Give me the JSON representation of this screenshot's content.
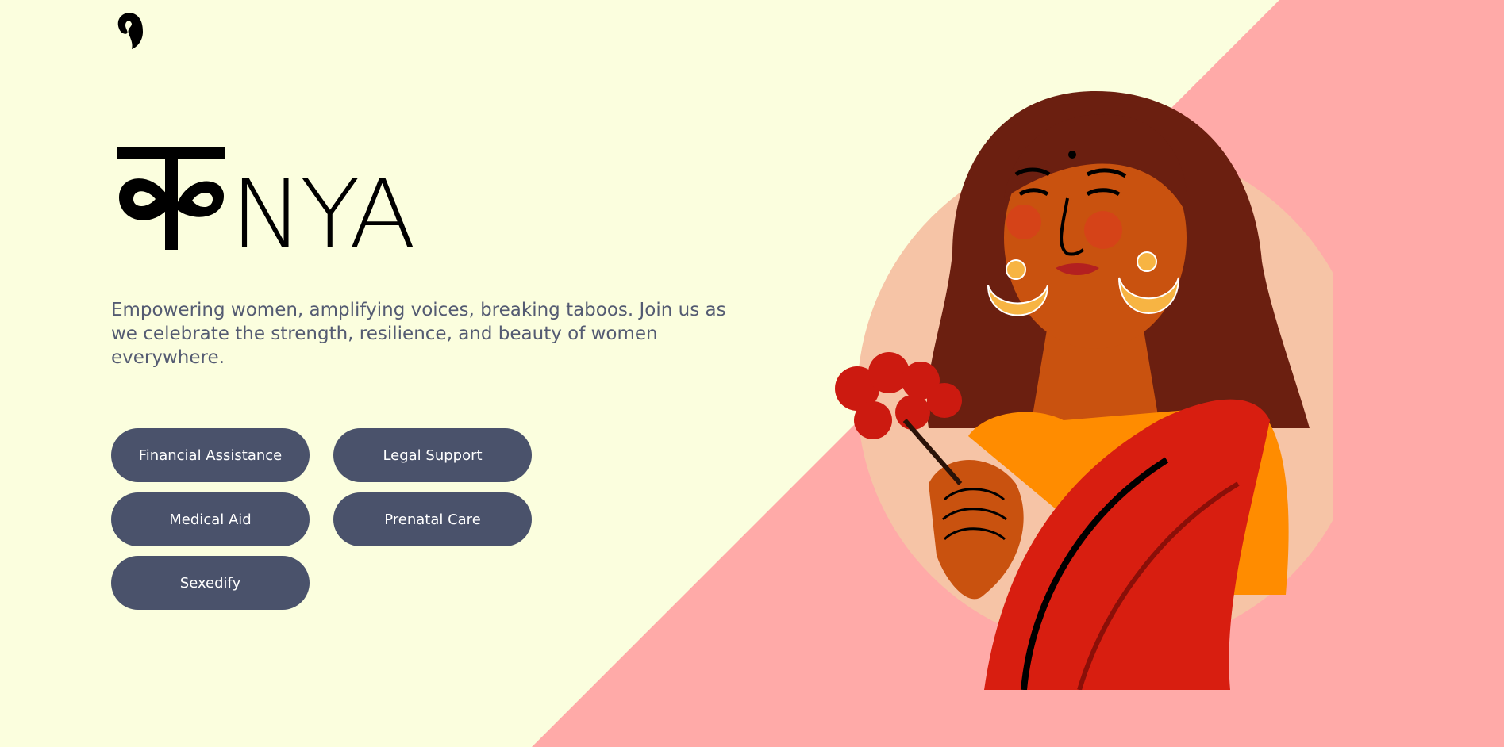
{
  "brand": {
    "logo_alt": "hair-silhouette-logo",
    "wordmark_devanagari": "क",
    "wordmark_latin": "NYA"
  },
  "hero": {
    "tagline": "Empowering women, amplifying voices, breaking taboos. Join us as we celebrate the strength, resilience, and beauty of women everywhere."
  },
  "services": [
    {
      "label": "Financial Assistance"
    },
    {
      "label": "Legal Support"
    },
    {
      "label": "Medical Aid"
    },
    {
      "label": "Prenatal Care"
    },
    {
      "label": "Sexedify"
    }
  ],
  "colors": {
    "background": "#fbfede",
    "accent_pink": "#ffaaa8",
    "button": "#4a526b",
    "text": "#545b72"
  }
}
